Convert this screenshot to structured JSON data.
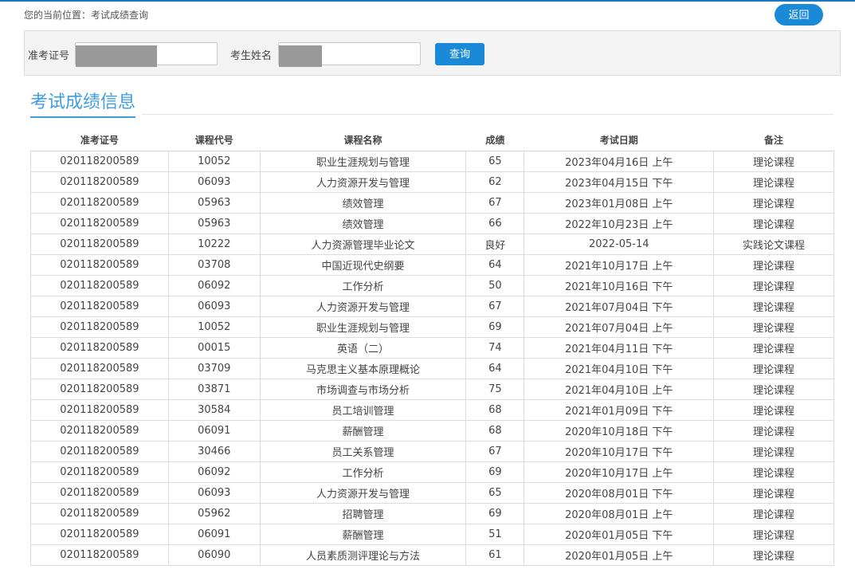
{
  "breadcrumb": "您的当前位置：考试成绩查询",
  "back_label": "返回",
  "search": {
    "admission_label": "准考证号",
    "name_label": "考生姓名",
    "query_label": "查询"
  },
  "section_title": "考试成绩信息",
  "table": {
    "headers": [
      "准考证号",
      "课程代号",
      "课程名称",
      "成绩",
      "考试日期",
      "备注"
    ],
    "rows": [
      [
        "020118200589",
        "10052",
        "职业生涯规划与管理",
        "65",
        "2023年04月16日 上午",
        "理论课程"
      ],
      [
        "020118200589",
        "06093",
        "人力资源开发与管理",
        "62",
        "2023年04月15日 下午",
        "理论课程"
      ],
      [
        "020118200589",
        "05963",
        "绩效管理",
        "67",
        "2023年01月08日 上午",
        "理论课程"
      ],
      [
        "020118200589",
        "05963",
        "绩效管理",
        "66",
        "2022年10月23日 上午",
        "理论课程"
      ],
      [
        "020118200589",
        "10222",
        "人力资源管理毕业论文",
        "良好",
        "2022-05-14",
        "实践论文课程"
      ],
      [
        "020118200589",
        "03708",
        "中国近现代史纲要",
        "64",
        "2021年10月17日 上午",
        "理论课程"
      ],
      [
        "020118200589",
        "06092",
        "工作分析",
        "50",
        "2021年10月16日 下午",
        "理论课程"
      ],
      [
        "020118200589",
        "06093",
        "人力资源开发与管理",
        "67",
        "2021年07月04日 下午",
        "理论课程"
      ],
      [
        "020118200589",
        "10052",
        "职业生涯规划与管理",
        "69",
        "2021年07月04日 上午",
        "理论课程"
      ],
      [
        "020118200589",
        "00015",
        "英语（二）",
        "74",
        "2021年04月11日 下午",
        "理论课程"
      ],
      [
        "020118200589",
        "03709",
        "马克思主义基本原理概论",
        "64",
        "2021年04月10日 下午",
        "理论课程"
      ],
      [
        "020118200589",
        "03871",
        "市场调查与市场分析",
        "75",
        "2021年04月10日 上午",
        "理论课程"
      ],
      [
        "020118200589",
        "30584",
        "员工培训管理",
        "68",
        "2021年01月09日 下午",
        "理论课程"
      ],
      [
        "020118200589",
        "06091",
        "薪酬管理",
        "68",
        "2020年10月18日 下午",
        "理论课程"
      ],
      [
        "020118200589",
        "30466",
        "员工关系管理",
        "67",
        "2020年10月17日 下午",
        "理论课程"
      ],
      [
        "020118200589",
        "06092",
        "工作分析",
        "69",
        "2020年10月17日 上午",
        "理论课程"
      ],
      [
        "020118200589",
        "06093",
        "人力资源开发与管理",
        "65",
        "2020年08月01日 下午",
        "理论课程"
      ],
      [
        "020118200589",
        "05962",
        "招聘管理",
        "69",
        "2020年08月01日 上午",
        "理论课程"
      ],
      [
        "020118200589",
        "06091",
        "薪酬管理",
        "51",
        "2020年01月05日 下午",
        "理论课程"
      ],
      [
        "020118200589",
        "06090",
        "人员素质测评理论与方法",
        "61",
        "2020年01月05日 上午",
        "理论课程"
      ]
    ]
  }
}
